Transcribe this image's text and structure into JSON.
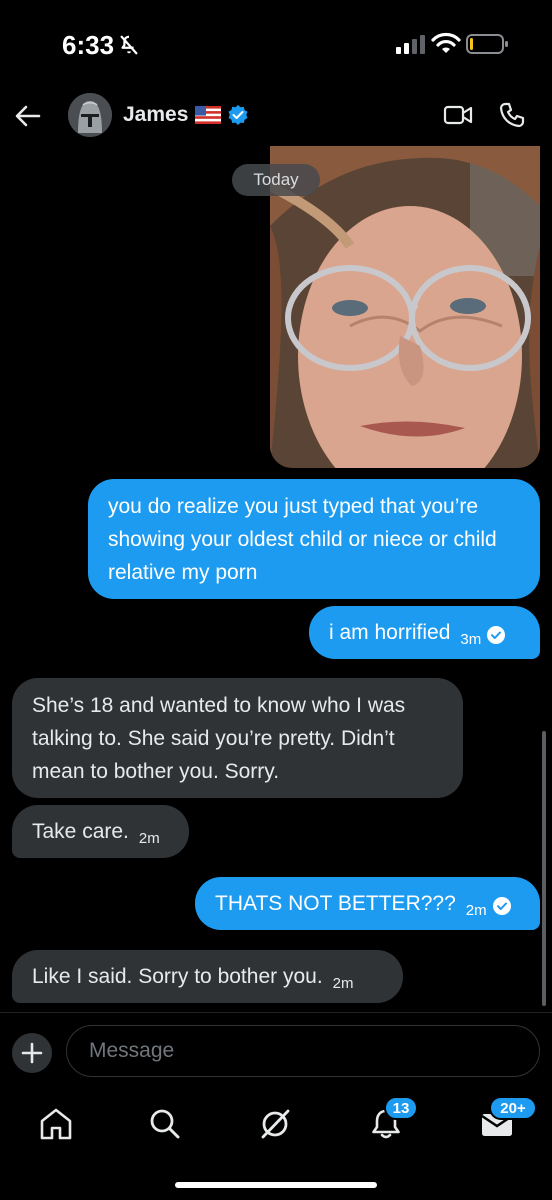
{
  "status_bar": {
    "time": "6:33"
  },
  "header": {
    "contact_name": "James"
  },
  "chat": {
    "date_label": "Today",
    "messages": [
      {
        "from": "me",
        "text": "you do realize you just typed that you’re showing your oldest child or niece or child relative my porn",
        "time": ""
      },
      {
        "from": "me",
        "text": "i am horrified",
        "time": "3m",
        "read": true
      },
      {
        "from": "them",
        "text": "She’s 18 and wanted to know who I was talking to. She said you’re pretty. Didn’t mean to bother you. Sorry.",
        "time": ""
      },
      {
        "from": "them",
        "text": "Take care.",
        "time": "2m"
      },
      {
        "from": "me",
        "text": "THATS NOT BETTER???",
        "time": "2m",
        "read": true
      },
      {
        "from": "them",
        "text": "Like I said. Sorry to bother you.",
        "time": "2m"
      }
    ]
  },
  "composer": {
    "placeholder": "Message"
  },
  "tabbar": {
    "notifications_badge": "13",
    "messages_badge": "20+"
  },
  "colors": {
    "accent": "#1d9bf0",
    "received_bubble": "#2f3336",
    "background": "#000000"
  },
  "icons": [
    "mute-icon",
    "signal-icon",
    "wifi-icon",
    "battery-icon",
    "back-arrow-icon",
    "us-flag-icon",
    "verified-icon",
    "video-call-icon",
    "phone-icon",
    "plus-icon",
    "home-icon",
    "search-icon",
    "grok-icon",
    "bell-icon",
    "mail-icon"
  ]
}
